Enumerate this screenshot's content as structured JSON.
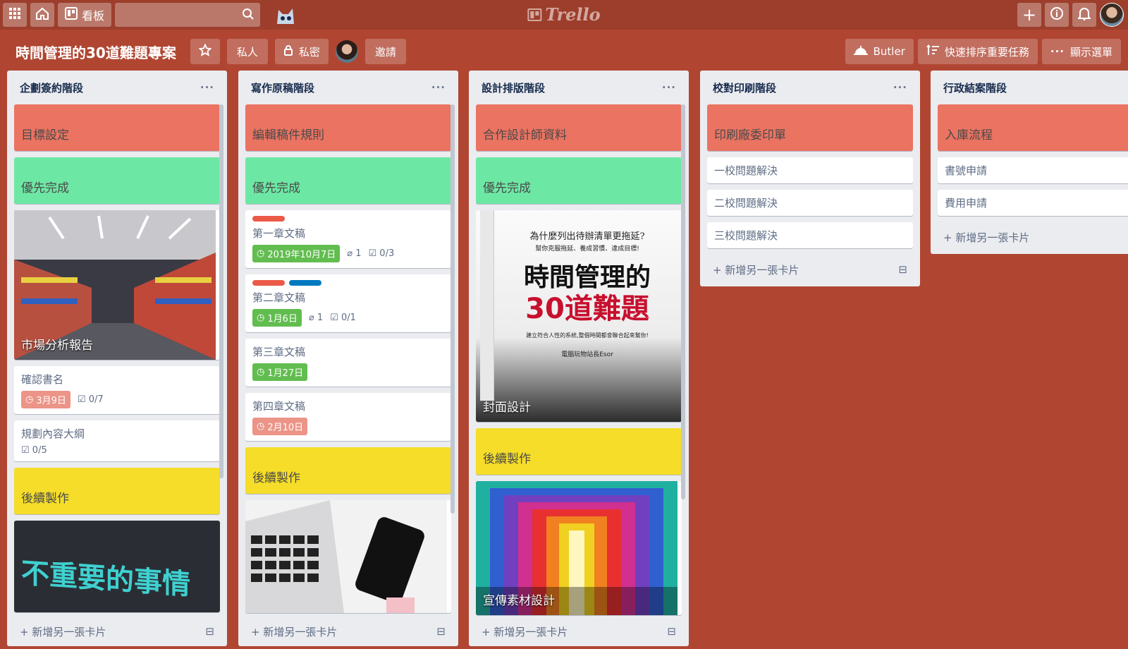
{
  "topbar": {
    "board_btn": "看板",
    "search_placeholder": "",
    "logo_text": "Trello"
  },
  "board": {
    "title": "時間管理的30道難題專案",
    "visibility": "私人",
    "privacy": "私密",
    "invite": "邀請",
    "butler": "Butler",
    "sort": "快速排序重要任務",
    "menu": "顯示選單"
  },
  "add_card": "新增另一張卡片",
  "colors": {
    "red": "#eb7361",
    "green": "#6de8a4",
    "yellow": "#f5dd29",
    "label_red": "#eb5a46",
    "label_blue": "#0079bf"
  },
  "lists": [
    {
      "title": "企劃簽約階段",
      "cards": {
        "c1": "目標設定",
        "c2": "優先完成",
        "c3": "市場分析報告",
        "c4": "確認書名",
        "c4_due": "3月9日",
        "c4_check": "0/7",
        "c5": "規劃內容大綱",
        "c5_check": "0/5",
        "c6": "後續製作",
        "c7_img_text": "不重要的事情"
      }
    },
    {
      "title": "寫作原稿階段",
      "cards": {
        "c1": "編輯稿件規則",
        "c2": "優先完成",
        "c3": "第一章文稿",
        "c3_due": "2019年10月7日",
        "c3_attach": "1",
        "c3_check": "0/3",
        "c4": "第二章文稿",
        "c4_due": "1月6日",
        "c4_attach": "1",
        "c4_check": "0/1",
        "c5": "第三章文稿",
        "c5_due": "1月27日",
        "c6": "第四章文稿",
        "c6_due": "2月10日",
        "c7": "後續製作"
      }
    },
    {
      "title": "設計排版階段",
      "cards": {
        "c1": "合作設計師資料",
        "c2": "優先完成",
        "c3": "封面設計",
        "book_sub": "為什麼列出待辦清單更拖延?",
        "book_sub2": "幫你克服拖延、養成習慣、達成目標!",
        "book_title1": "時間管理的",
        "book_title2": "30道難題",
        "book_tag": "建立符合人性的系統,整個時間都會聯合起來幫你!",
        "book_author": "電腦玩物站長Esor",
        "c4": "後續製作",
        "c5": "宣傳素材設計"
      }
    },
    {
      "title": "校對印刷階段",
      "cards": {
        "c1": "印刷廠委印單",
        "c2": "一校問題解決",
        "c3": "二校問題解決",
        "c4": "三校問題解決"
      }
    },
    {
      "title": "行政結案階段",
      "cards": {
        "c1": "入庫流程",
        "c2": "書號申請",
        "c3": "費用申請"
      }
    }
  ]
}
